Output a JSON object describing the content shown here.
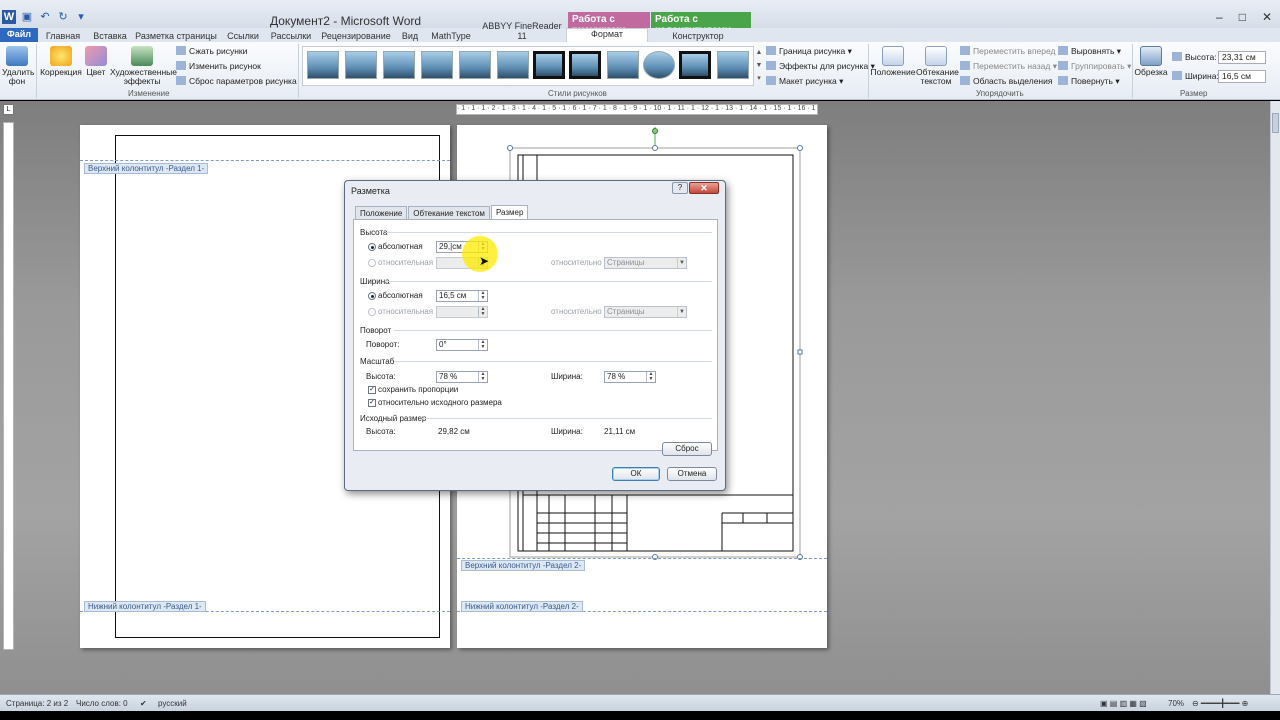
{
  "window": {
    "title": "Документ2 - Microsoft Word",
    "context_tabs": [
      "Работа с рисунками",
      "Работа с колонтитулами"
    ],
    "controls": [
      "–",
      "□",
      "✕"
    ]
  },
  "ribbon_tabs": [
    "Файл",
    "Главная",
    "Вставка",
    "Разметка страницы",
    "Ссылки",
    "Рассылки",
    "Рецензирование",
    "Вид",
    "MathType",
    "ABBYY FineReader 11",
    "Формат",
    "Конструктор"
  ],
  "ribbon": {
    "remove_bg": [
      "Удалить",
      "фон"
    ],
    "correction": "Коррекция",
    "color": "Цвет",
    "artistic": [
      "Художественные",
      "эффекты"
    ],
    "compress": "Сжать рисунки",
    "change": "Изменить рисунок",
    "reset": "Сброс параметров рисунка",
    "group_adjust": "Изменение",
    "group_styles": "Стили рисунков",
    "border": "Граница рисунка",
    "effects": "Эффекты для рисунка",
    "layout": "Макет рисунка",
    "position": "Положение",
    "wrap": [
      "Обтекание",
      "текстом"
    ],
    "bring_forward": "Переместить вперед",
    "send_backward": "Переместить назад",
    "selection_pane": "Область выделения",
    "align": "Выровнять",
    "group": "Группировать",
    "rotate": "Повернуть",
    "group_arrange": "Упорядочить",
    "crop": "Обрезка",
    "height_label": "Высота:",
    "height_value": "23,31 см",
    "width_label": "Ширина:",
    "width_value": "16,5 см",
    "group_size": "Размер"
  },
  "ruler_text": "· 1 · 1 · 1 · 2 · 1 · 3 · 1 · 4 · 1 · 5 · 1 · 6 · 1 · 7 · 1 · 8 · 1 · 9 · 1 · 10 · 1 · 11 · 1 · 12 · 1 · 13 · 1 · 14 · 1 · 15 · 1 · 16 · 1 · 17",
  "document": {
    "header_sec1": "Верхний колонтитул -Раздел 1-",
    "footer_sec1": "Нижний колонтитул -Раздел 1-",
    "header_sec2": "Верхний колонтитул -Раздел 2-",
    "footer_sec2": "Нижний колонтитул -Раздел 2-"
  },
  "dialog": {
    "title": "Разметка",
    "help": "?",
    "close": "✕",
    "tabs": [
      "Положение",
      "Обтекание текстом",
      "Размер"
    ],
    "height_section": "Высота",
    "absolute": "абсолютная",
    "relative": "относительная",
    "height_abs_value": "29,|см",
    "relative_to": "относительно",
    "relative_to_option": "Страницы",
    "width_section": "Ширина",
    "width_abs_value": "16,5 см",
    "rotation_section": "Поворот",
    "rotation_label": "Поворот:",
    "rotation_value": "0°",
    "scale_section": "Масштаб",
    "scale_height_label": "Высота:",
    "scale_height_value": "78 %",
    "scale_width_label": "Ширина:",
    "scale_width_value": "78 %",
    "lock_aspect": "сохранить пропорции",
    "relative_original": "относительно исходного размера",
    "original_section": "Исходный размер",
    "orig_height_label": "Высота:",
    "orig_height_value": "29,82 см",
    "orig_width_label": "Ширина:",
    "orig_width_value": "21,11 см",
    "reset": "Сброс",
    "ok": "ОК",
    "cancel": "Отмена"
  },
  "statusbar": {
    "pages": "Страница: 2 из 2",
    "words": "Число слов: 0",
    "language": "русский",
    "zoom": "70%"
  }
}
